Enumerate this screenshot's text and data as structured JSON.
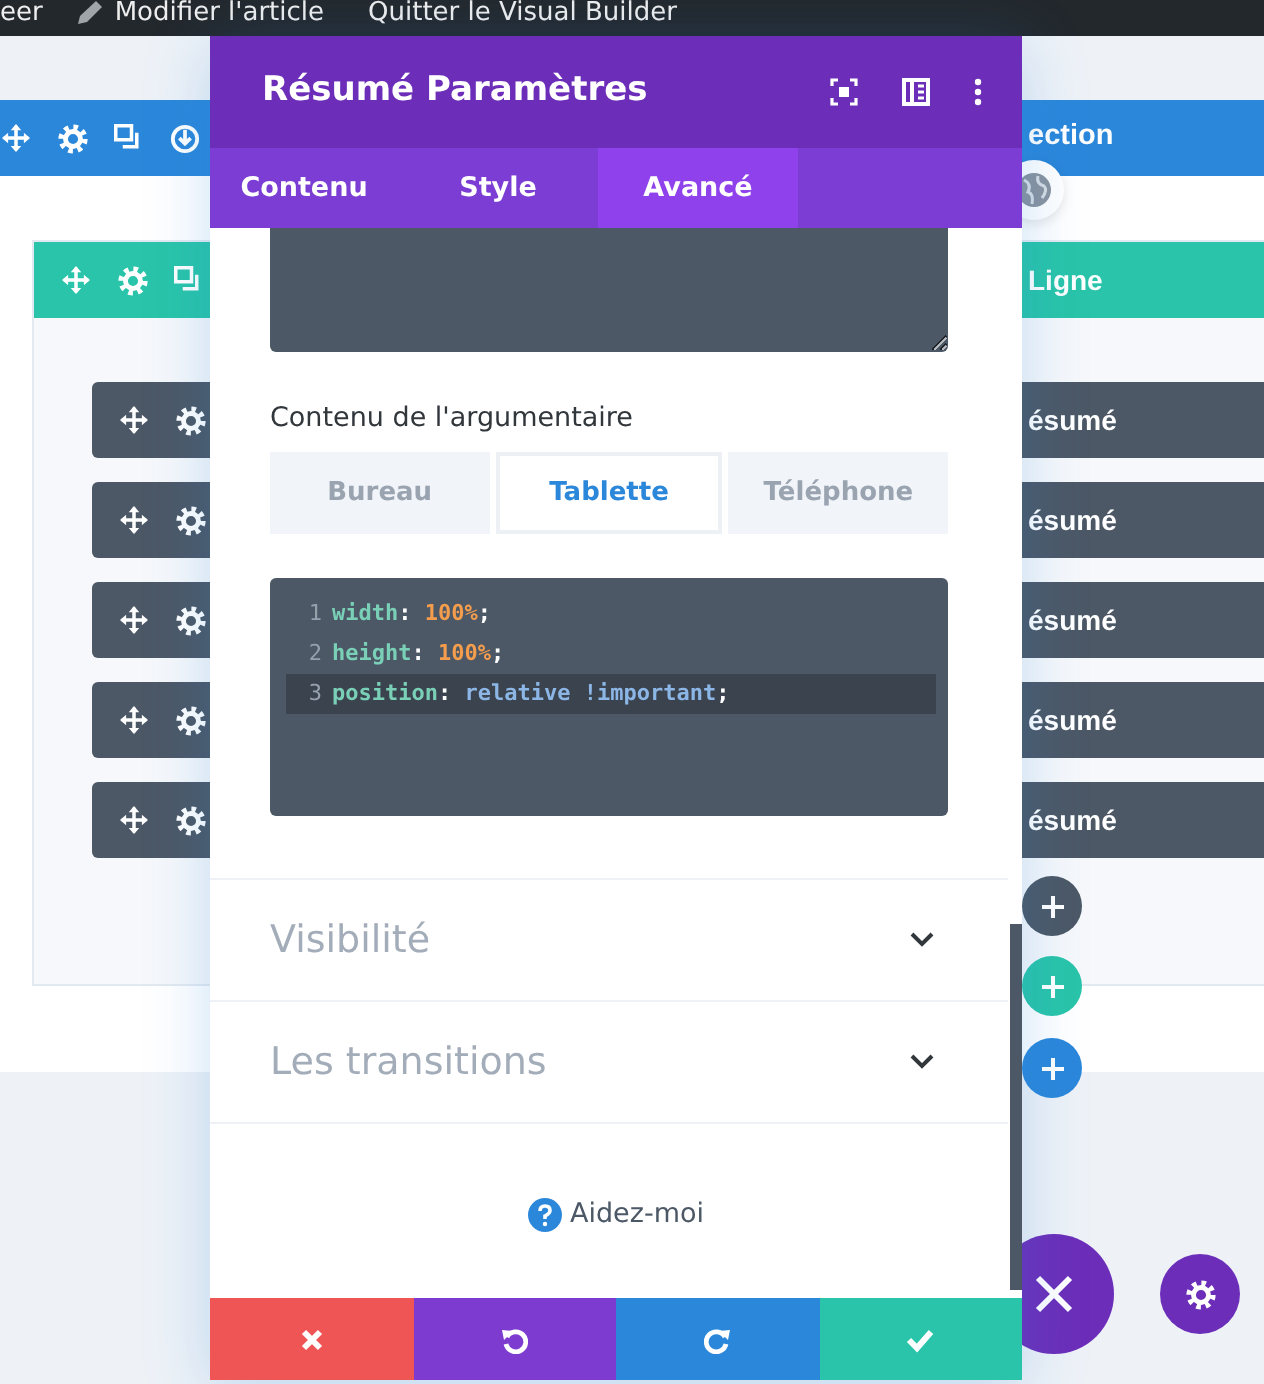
{
  "admin_bar": {
    "items": [
      {
        "kind": "text",
        "label": "eer"
      },
      {
        "kind": "edit",
        "label": "Modifier l'article"
      },
      {
        "kind": "text",
        "label": "Quitter le Visual Builder"
      }
    ]
  },
  "builder": {
    "section_label": "ection",
    "row_label": "Ligne",
    "modules": [
      {
        "label": "ésumé"
      },
      {
        "label": "ésumé"
      },
      {
        "label": "ésumé"
      },
      {
        "label": "ésumé"
      },
      {
        "label": "ésumé"
      }
    ],
    "add_buttons": [
      {
        "color": "#4c5866"
      },
      {
        "color": "#29c4a9"
      },
      {
        "color": "#2b87da"
      }
    ]
  },
  "modal": {
    "title": "Résumé Paramètres",
    "tabs": [
      {
        "label": "Contenu",
        "selected": false
      },
      {
        "label": "Style",
        "selected": false
      },
      {
        "label": "Avancé",
        "selected": true
      }
    ],
    "field_label": "Contenu de l'argumentaire",
    "device_tabs": [
      {
        "label": "Bureau",
        "selected": false
      },
      {
        "label": "Tablette",
        "selected": true
      },
      {
        "label": "Téléphone",
        "selected": false
      }
    ],
    "code_lines": [
      {
        "number": "1",
        "highlighted": false,
        "tokens": [
          {
            "kind": "property",
            "text": "width"
          },
          {
            "kind": "punct",
            "text": ": "
          },
          {
            "kind": "number",
            "text": "100%"
          },
          {
            "kind": "punct",
            "text": ";"
          }
        ]
      },
      {
        "number": "2",
        "highlighted": false,
        "tokens": [
          {
            "kind": "property",
            "text": "height"
          },
          {
            "kind": "punct",
            "text": ": "
          },
          {
            "kind": "number",
            "text": "100%"
          },
          {
            "kind": "punct",
            "text": ";"
          }
        ]
      },
      {
        "number": "3",
        "highlighted": true,
        "tokens": [
          {
            "kind": "property",
            "text": "position"
          },
          {
            "kind": "punct",
            "text": ": "
          },
          {
            "kind": "keyword",
            "text": "relative !important"
          },
          {
            "kind": "punct",
            "text": ";"
          }
        ]
      }
    ],
    "toggles": [
      {
        "label": "Visibilité",
        "expanded": false
      },
      {
        "label": "Les transitions",
        "expanded": false
      }
    ],
    "help": "Aidez-moi",
    "actions": [
      {
        "kind": "discard",
        "color": "#ef5555"
      },
      {
        "kind": "undo",
        "color": "#7e3bd0"
      },
      {
        "kind": "redo",
        "color": "#2b87da"
      },
      {
        "kind": "save",
        "color": "#29c4a9"
      }
    ]
  }
}
